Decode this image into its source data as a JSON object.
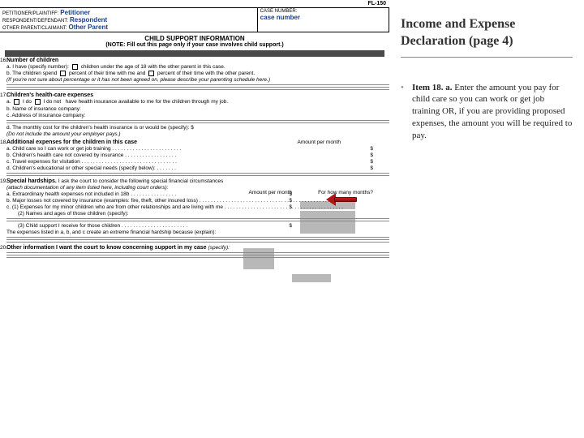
{
  "formCode": "FL-150",
  "header": {
    "petLabel": "PETITIONER/PLAINTIFF:",
    "petValue": "Petitioner",
    "respLabel": "RESPONDENT/DEFENDANT:",
    "respValue": "Respondent",
    "otherLabel": "OTHER PARENT/CLAIMANT:",
    "otherValue": "Other Parent",
    "caseLabel": "CASE NUMBER:",
    "caseValue": "case number"
  },
  "title": "CHILD SUPPORT INFORMATION",
  "note": "(NOTE: Fill out this page only if your case involves child support.)",
  "s16": {
    "num": "16.",
    "title": "Number of children",
    "a": "a.  I have  (specify number):",
    "a2": "children under the age of 18 with the other parent in this case.",
    "b": "b.  The children spend",
    "b2": "percent of their time with me and",
    "b3": "percent of their time with the other parent.",
    "bnote": "(If you're not sure about percentage or it has not been agreed on, please describe your parenting schedule here.)"
  },
  "s17": {
    "num": "17.",
    "title": "Children's health-care expenses",
    "a": "a.",
    "do": "I do",
    "donot": "I do not",
    "a2": "have health insurance available to me for the children through my job.",
    "b": "b.  Name of insurance company:",
    "c": "c.  Address of insurance company:",
    "d": "d.  The monthly cost for the children's health insurance is or would be (specify):   $",
    "dnote": "(Do not include the amount your employer pays.)"
  },
  "s18": {
    "num": "18.",
    "title": "Additional expenses for the children in this case",
    "header": "Amount per month",
    "a": "a.  Child care so I can work or get job training . . . . . . . . . . . . . . . . . . . . . . . .",
    "b": "b.  Children's health care not covered by insurance . . . . . . . . . . . . . . . . . .",
    "c": "c.  Travel expenses for visitation . . . . . . . . . . . . . . . . . . . . . . . . . . . . . . . . .",
    "d": "d.  Children's educational or other special needs (specify below): . . . . . . .",
    "dollar": "$"
  },
  "s19": {
    "num": "19.",
    "title": "Special hardships.",
    "lead": "I ask the court to consider the following special financial circumstances",
    "note": "(attach documentation of any item listed here, including court orders):",
    "h1": "Amount per month",
    "h2": "For how many months?",
    "a": "a.  Extraordinary health expenses not included in 18b . . . . . . . . . . . . . . . .",
    "b": "b.  Major losses not covered by insurance (examples: fire, theft, other insured loss) . . . . . . . . . . . . . . . . . . . . . . . . . . . . . . . . . . . . . . . . . . . . . . . .",
    "c1": "c. (1) Expenses for my minor children who are from other relationships and are living with me . . . . . . . . . . . . . . . . . . . . . . . . . . . . . . . . . . . . . . . . .",
    "c2": "(2) Names and ages of those children (specify):",
    "c3": "(3) Child support I receive for those children . . . . . . . . . . . . . . . . . . . . . . .",
    "explain": "The expenses listed in a, b, and c create an extreme financial hardship because (explain):",
    "dollar": "$"
  },
  "s20": {
    "num": "20.",
    "title": "Other information I want the court to know concerning support in my case",
    "lead": "(specify):"
  },
  "right": {
    "title": "Income and Expense Declaration (page 4)",
    "itemLabel": "Item 18. a.",
    "itemText": "Enter the amount you pay for child care so you can work or get job training OR, if you are providing proposed expenses, the amount you will be required to pay."
  }
}
